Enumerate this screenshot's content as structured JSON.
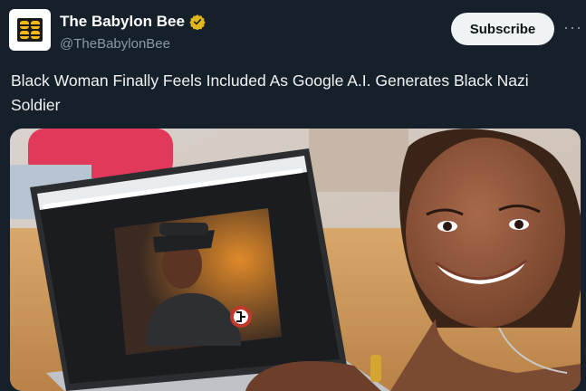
{
  "account": {
    "name": "The Babylon Bee",
    "handle": "@TheBabylonBee",
    "verified": true,
    "avatar_icon": "bee-logo-icon"
  },
  "actions": {
    "subscribe_label": "Subscribe",
    "more_label": "···"
  },
  "post": {
    "text": "Black Woman Finally Feels Included As Google A.I. Generates Black Nazi Soldier"
  },
  "media": {
    "description_icon": "photo-laptop-woman"
  },
  "colors": {
    "background": "#15202b",
    "verified_badge": "#e2b719",
    "subscribe_bg": "#eff3f4"
  }
}
